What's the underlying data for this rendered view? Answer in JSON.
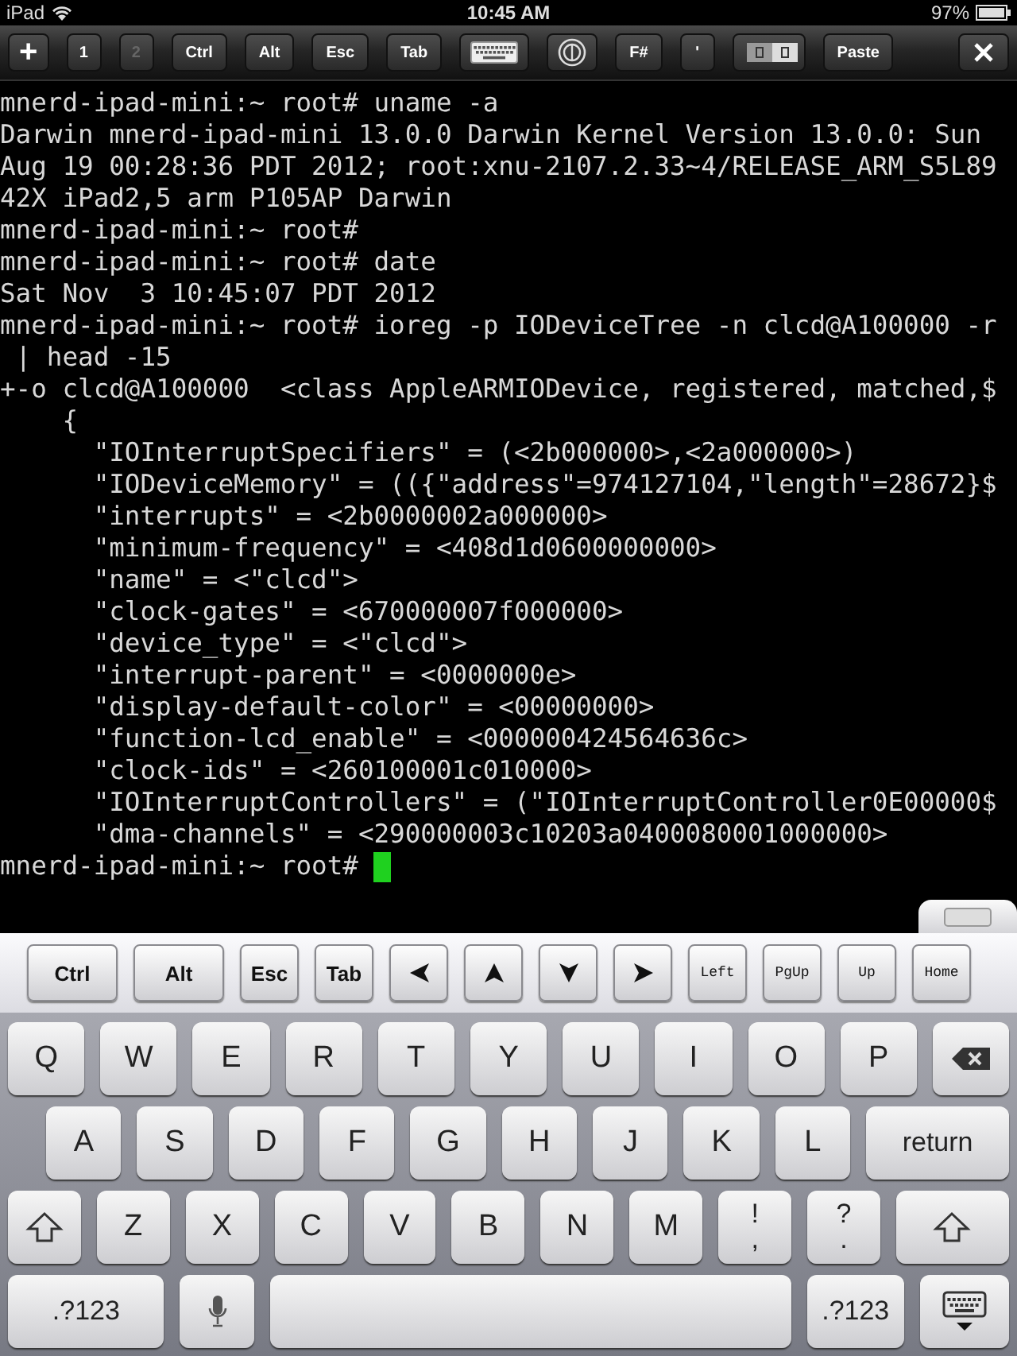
{
  "status_bar": {
    "carrier": "iPad",
    "time": "10:45 AM",
    "battery": "97%"
  },
  "toolbar": [
    {
      "kind": "glyph",
      "label": "+",
      "disabled": false
    },
    {
      "kind": "text",
      "label": "1",
      "disabled": false
    },
    {
      "kind": "text",
      "label": "2",
      "disabled": true
    },
    {
      "kind": "text",
      "label": "Ctrl",
      "disabled": false
    },
    {
      "kind": "text",
      "label": "Alt",
      "disabled": false
    },
    {
      "kind": "text",
      "label": "Esc",
      "disabled": false
    },
    {
      "kind": "text",
      "label": "Tab",
      "disabled": false
    },
    {
      "kind": "keyboard",
      "disabled": false
    },
    {
      "kind": "circle",
      "disabled": false
    },
    {
      "kind": "text",
      "label": "F#",
      "disabled": false
    },
    {
      "kind": "text",
      "label": "'",
      "disabled": false
    },
    {
      "kind": "ca",
      "disabled": false
    },
    {
      "kind": "text",
      "label": "Paste",
      "disabled": false
    },
    {
      "kind": "close",
      "disabled": false
    }
  ],
  "terminal": {
    "lines": [
      "mnerd-ipad-mini:~ root# uname -a",
      "Darwin mnerd-ipad-mini 13.0.0 Darwin Kernel Version 13.0.0: Sun",
      "Aug 19 00:28:36 PDT 2012; root:xnu-2107.2.33~4/RELEASE_ARM_S5L89",
      "42X iPad2,5 arm P105AP Darwin",
      "mnerd-ipad-mini:~ root#",
      "mnerd-ipad-mini:~ root# date",
      "Sat Nov  3 10:45:07 PDT 2012",
      "mnerd-ipad-mini:~ root# ioreg -p IODeviceTree -n clcd@A100000 -r",
      " | head -15",
      "+-o clcd@A100000  <class AppleARMIODevice, registered, matched,$",
      "    {",
      "      \"IOInterruptSpecifiers\" = (<2b000000>,<2a000000>)",
      "      \"IODeviceMemory\" = (({\"address\"=974127104,\"length\"=28672}$",
      "      \"interrupts\" = <2b0000002a000000>",
      "      \"minimum-frequency\" = <408d1d0600000000>",
      "      \"name\" = <\"clcd\">",
      "      \"clock-gates\" = <670000007f000000>",
      "      \"device_type\" = <\"clcd\">",
      "      \"interrupt-parent\" = <0000000e>",
      "      \"display-default-color\" = <00000000>",
      "      \"function-lcd_enable\" = <000000424564636c>",
      "      \"clock-ids\" = <260100001c010000>",
      "      \"IOInterruptControllers\" = (\"IOInterruptController0E00000$",
      "      \"dma-channels\" = <290000003c10203a0400080001000000>"
    ],
    "prompt": "mnerd-ipad-mini:~ root# "
  },
  "extra_keys": [
    {
      "kind": "wide",
      "label": "Ctrl"
    },
    {
      "kind": "wide",
      "label": "Alt"
    },
    {
      "kind": "std",
      "label": "Esc"
    },
    {
      "kind": "std",
      "label": "Tab"
    },
    {
      "kind": "arrow_left"
    },
    {
      "kind": "arrow_up"
    },
    {
      "kind": "arrow_down"
    },
    {
      "kind": "arrow_right"
    },
    {
      "kind": "mono",
      "label": "Left"
    },
    {
      "kind": "mono",
      "label": "PgUp"
    },
    {
      "kind": "mono",
      "label": "Up"
    },
    {
      "kind": "mono",
      "label": "Home"
    }
  ],
  "keyboard": [
    [
      {
        "kind": "letter",
        "label": "Q"
      },
      {
        "kind": "letter",
        "label": "W"
      },
      {
        "kind": "letter",
        "label": "E"
      },
      {
        "kind": "letter",
        "label": "R"
      },
      {
        "kind": "letter",
        "label": "T"
      },
      {
        "kind": "letter",
        "label": "Y"
      },
      {
        "kind": "letter",
        "label": "U"
      },
      {
        "kind": "letter",
        "label": "I"
      },
      {
        "kind": "letter",
        "label": "O"
      },
      {
        "kind": "letter",
        "label": "P"
      },
      {
        "kind": "backspace"
      }
    ],
    [
      {
        "kind": "letter",
        "label": "A"
      },
      {
        "kind": "letter",
        "label": "S"
      },
      {
        "kind": "letter",
        "label": "D"
      },
      {
        "kind": "letter",
        "label": "F"
      },
      {
        "kind": "letter",
        "label": "G"
      },
      {
        "kind": "letter",
        "label": "H"
      },
      {
        "kind": "letter",
        "label": "J"
      },
      {
        "kind": "letter",
        "label": "K"
      },
      {
        "kind": "letter",
        "label": "L"
      },
      {
        "kind": "return",
        "label": "return"
      }
    ],
    [
      {
        "kind": "shift"
      },
      {
        "kind": "letter",
        "label": "Z"
      },
      {
        "kind": "letter",
        "label": "X"
      },
      {
        "kind": "letter",
        "label": "C"
      },
      {
        "kind": "letter",
        "label": "V"
      },
      {
        "kind": "letter",
        "label": "B"
      },
      {
        "kind": "letter",
        "label": "N"
      },
      {
        "kind": "letter",
        "label": "M"
      },
      {
        "kind": "dual",
        "label": "!",
        "sub": ","
      },
      {
        "kind": "dual",
        "label": "?",
        "sub": "."
      },
      {
        "kind": "shift2"
      }
    ],
    [
      {
        "kind": "mode",
        "label": ".?123"
      },
      {
        "kind": "mic"
      },
      {
        "kind": "space"
      },
      {
        "kind": "mode2",
        "label": ".?123"
      },
      {
        "kind": "hide"
      }
    ]
  ]
}
